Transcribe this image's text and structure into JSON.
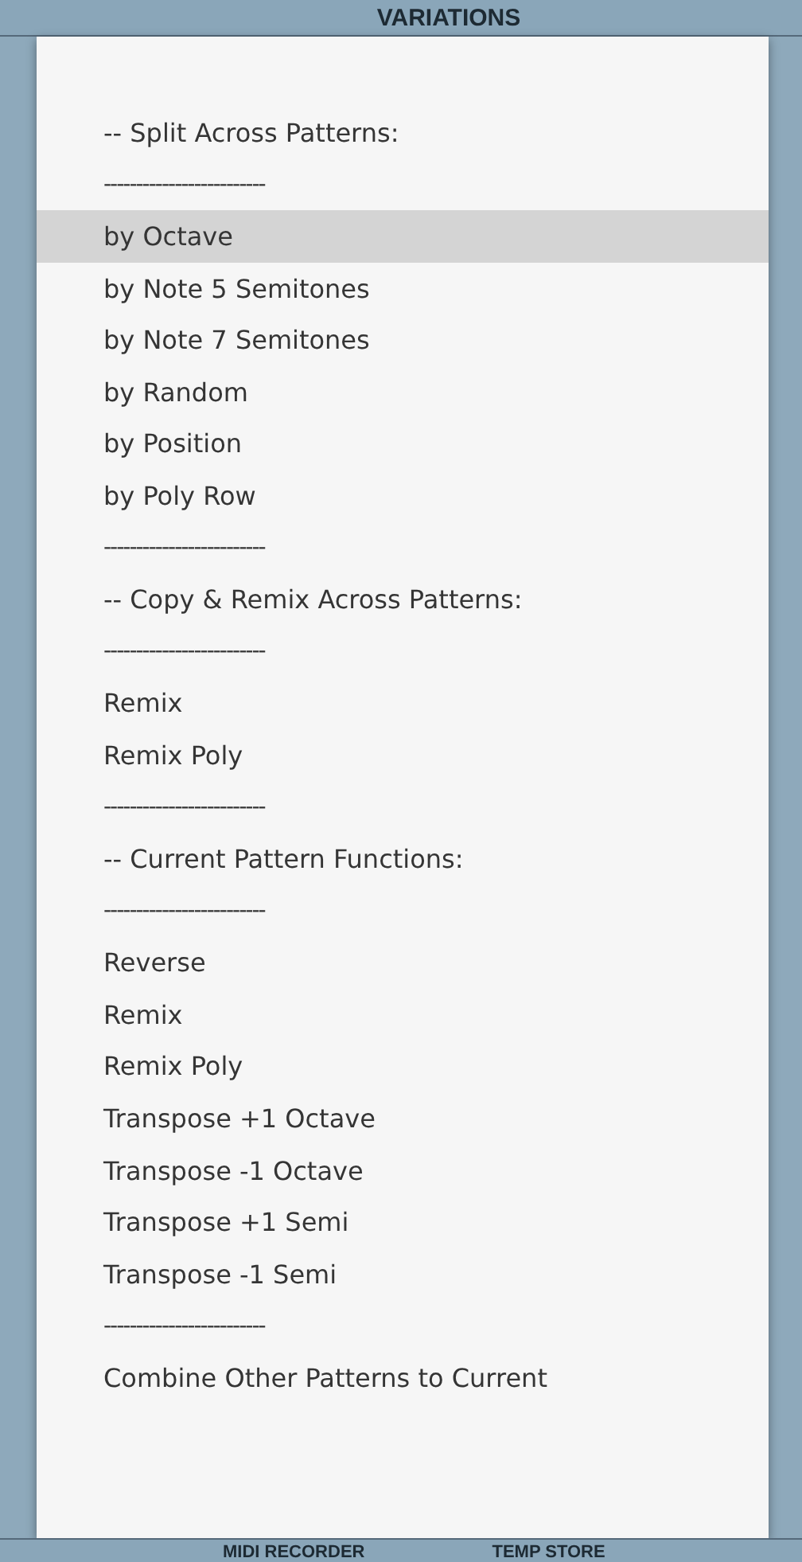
{
  "background": {
    "top_title": "VARIATIONS",
    "bottom_titles": [
      "MIDI RECORDER",
      "TEMP STORE"
    ]
  },
  "menu": {
    "items": [
      {
        "kind": "header",
        "label": "-- Split Across Patterns:"
      },
      {
        "kind": "separator",
        "label": "-------------------------"
      },
      {
        "kind": "option",
        "label": "by Octave",
        "selected": true
      },
      {
        "kind": "option",
        "label": "by Note 5 Semitones",
        "selected": false
      },
      {
        "kind": "option",
        "label": "by Note 7 Semitones",
        "selected": false
      },
      {
        "kind": "option",
        "label": "by Random",
        "selected": false
      },
      {
        "kind": "option",
        "label": "by Position",
        "selected": false
      },
      {
        "kind": "option",
        "label": "by Poly Row",
        "selected": false
      },
      {
        "kind": "separator",
        "label": "-------------------------"
      },
      {
        "kind": "header",
        "label": "-- Copy & Remix Across Patterns:"
      },
      {
        "kind": "separator",
        "label": "-------------------------"
      },
      {
        "kind": "option",
        "label": "Remix",
        "selected": false
      },
      {
        "kind": "option",
        "label": "Remix Poly",
        "selected": false
      },
      {
        "kind": "separator",
        "label": "-------------------------"
      },
      {
        "kind": "header",
        "label": "-- Current Pattern Functions:"
      },
      {
        "kind": "separator",
        "label": "-------------------------"
      },
      {
        "kind": "option",
        "label": "Reverse",
        "selected": false
      },
      {
        "kind": "option",
        "label": "Remix",
        "selected": false
      },
      {
        "kind": "option",
        "label": "Remix Poly",
        "selected": false
      },
      {
        "kind": "option",
        "label": "Transpose +1 Octave",
        "selected": false
      },
      {
        "kind": "option",
        "label": "Transpose -1 Octave",
        "selected": false
      },
      {
        "kind": "option",
        "label": "Transpose +1 Semi",
        "selected": false
      },
      {
        "kind": "option",
        "label": "Transpose -1 Semi",
        "selected": false
      },
      {
        "kind": "separator",
        "label": "-------------------------"
      },
      {
        "kind": "option",
        "label": "Combine Other Patterns to Current",
        "selected": false
      }
    ]
  }
}
